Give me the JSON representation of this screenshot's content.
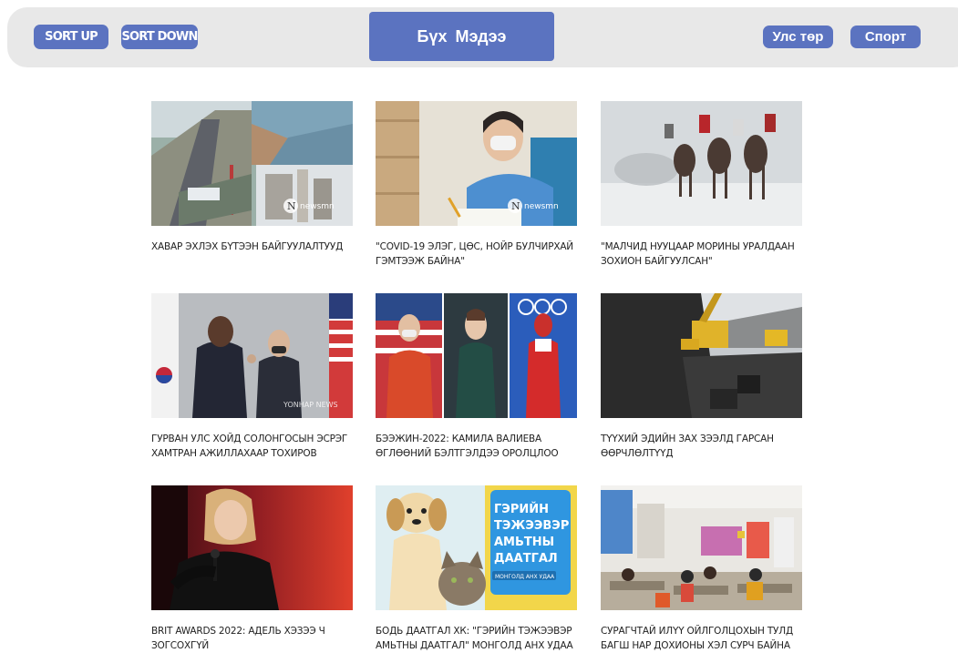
{
  "nav": {
    "sort_up": "SORT UP",
    "sort_down": "SORT DOWN",
    "all_news": "Бүх Мэдээ",
    "politics": "Улс төр",
    "sport": "Спорт"
  },
  "colors": {
    "accent": "#5b73c0",
    "bar": "#e8e8e8"
  },
  "watermarks": {
    "news": "newsmn",
    "yonhap": "YONHAP NEWS",
    "insurance_logo": "МОНГОЛД АНХ УДАА"
  },
  "articles": [
    {
      "title": "ХАВАР ЭХЛЭХ БҮТЭЭН БАЙГУУЛАЛТУУД",
      "image": "construction-collage"
    },
    {
      "title": "\"COVID-19 ЭЛЭГ, ЦӨС, НОЙР БУЛЧИРХАЙ ГЭМТЭЭЖ БАЙНА\"",
      "image": "doctor-portrait"
    },
    {
      "title": "\"МАЛЧИД НУУЦААР МОРИНЫ УРАЛДААН ЗОХИОН БАЙГУУЛСАН\"",
      "image": "horse-race"
    },
    {
      "title": "ГУРВАН УЛС ХОЙД СОЛОНГОСЫН ЭСРЭГ ХАМТРАН АЖИЛЛАХААР ТОХИРОВ",
      "image": "officials-fist-bump"
    },
    {
      "title": "БЭЭЖИН-2022: КАМИЛА ВАЛИЕВА ӨГЛӨӨНИЙ БЭЛТГЭЛДЭЭ ОРОЛЦЛОО",
      "image": "olympic-athletes"
    },
    {
      "title": "ТҮҮХИЙ ЭДИЙН ЗАХ ЗЭЭЛД ГАРСАН ӨӨРЧЛӨЛТҮҮД",
      "image": "coal-mining"
    },
    {
      "title": "BRIT AWARDS 2022: АДЕЛЬ ХЭЗЭЭ Ч ЗОГСОХГҮЙ",
      "image": "singer-on-stage"
    },
    {
      "title": "БОДЬ ДААТГАЛ ХК: \"ГЭРИЙН ТЭЖЭЭВЭР АМЬТНЫ ДААТГАЛ\" МОНГОЛД АНХ УДАА",
      "image": "pet-insurance"
    },
    {
      "title": "СУРАГЧТАЙ ИЛҮҮ ОЙЛГОЛЦОХЫН ТУЛД БАГШ НАР ДОХИОНЫ ХЭЛ СУРЧ БАЙНА",
      "image": "classroom"
    }
  ],
  "pet_ad": {
    "line1": "ГЭРИЙН",
    "line2": "ТЭЖЭЭВЭР",
    "line3": "АМЬТНЫ",
    "line4": "ДААТГАЛ"
  }
}
